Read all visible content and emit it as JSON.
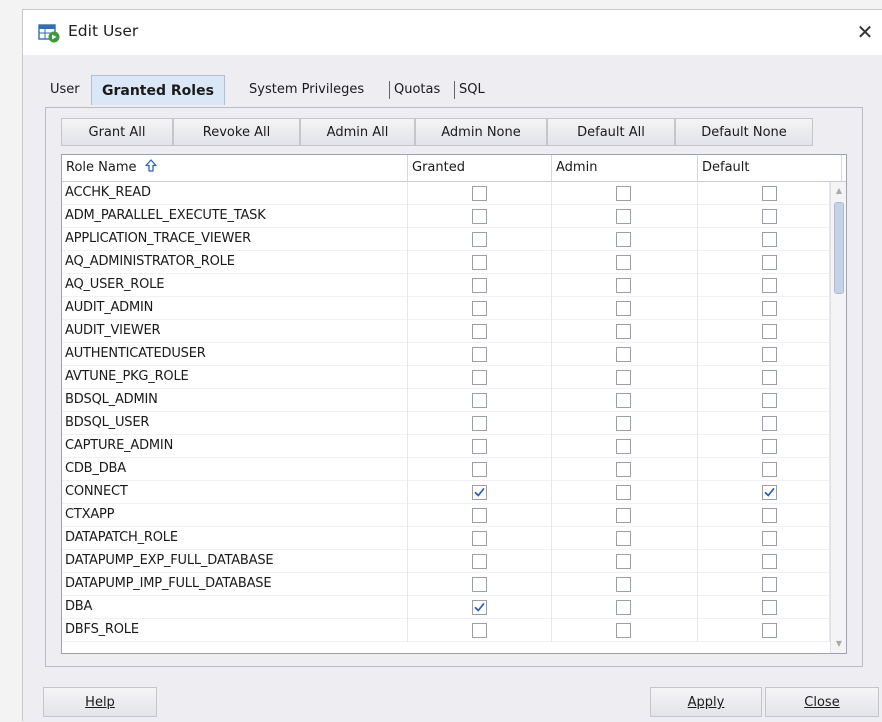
{
  "window": {
    "title": "Edit User",
    "close_glyph": "✕"
  },
  "tabs": [
    {
      "label": "User",
      "active": false
    },
    {
      "label": "Granted Roles",
      "active": true
    },
    {
      "label": "System Privileges",
      "active": false
    },
    {
      "label": "Quotas",
      "active": false
    },
    {
      "label": "SQL",
      "active": false
    }
  ],
  "toolbar": {
    "grant_all": "Grant All",
    "revoke_all": "Revoke All",
    "admin_all": "Admin All",
    "admin_none": "Admin None",
    "default_all": "Default All",
    "default_none": "Default None"
  },
  "grid": {
    "columns": [
      "Role Name",
      "Granted",
      "Admin",
      "Default"
    ],
    "sort_icon": "sort-ascending-icon",
    "rows": [
      {
        "name": "ACCHK_READ",
        "granted": false,
        "admin": false,
        "default": false
      },
      {
        "name": "ADM_PARALLEL_EXECUTE_TASK",
        "granted": false,
        "admin": false,
        "default": false
      },
      {
        "name": "APPLICATION_TRACE_VIEWER",
        "granted": false,
        "admin": false,
        "default": false
      },
      {
        "name": "AQ_ADMINISTRATOR_ROLE",
        "granted": false,
        "admin": false,
        "default": false
      },
      {
        "name": "AQ_USER_ROLE",
        "granted": false,
        "admin": false,
        "default": false
      },
      {
        "name": "AUDIT_ADMIN",
        "granted": false,
        "admin": false,
        "default": false
      },
      {
        "name": "AUDIT_VIEWER",
        "granted": false,
        "admin": false,
        "default": false
      },
      {
        "name": "AUTHENTICATEDUSER",
        "granted": false,
        "admin": false,
        "default": false
      },
      {
        "name": "AVTUNE_PKG_ROLE",
        "granted": false,
        "admin": false,
        "default": false
      },
      {
        "name": "BDSQL_ADMIN",
        "granted": false,
        "admin": false,
        "default": false
      },
      {
        "name": "BDSQL_USER",
        "granted": false,
        "admin": false,
        "default": false
      },
      {
        "name": "CAPTURE_ADMIN",
        "granted": false,
        "admin": false,
        "default": false
      },
      {
        "name": "CDB_DBA",
        "granted": false,
        "admin": false,
        "default": false
      },
      {
        "name": "CONNECT",
        "granted": true,
        "admin": false,
        "default": true
      },
      {
        "name": "CTXAPP",
        "granted": false,
        "admin": false,
        "default": false
      },
      {
        "name": "DATAPATCH_ROLE",
        "granted": false,
        "admin": false,
        "default": false
      },
      {
        "name": "DATAPUMP_EXP_FULL_DATABASE",
        "granted": false,
        "admin": false,
        "default": false
      },
      {
        "name": "DATAPUMP_IMP_FULL_DATABASE",
        "granted": false,
        "admin": false,
        "default": false
      },
      {
        "name": "DBA",
        "granted": true,
        "admin": false,
        "default": false
      },
      {
        "name": "DBFS_ROLE",
        "granted": false,
        "admin": false,
        "default": false
      }
    ]
  },
  "footer": {
    "help": "Help",
    "apply": "Apply",
    "close": "Close"
  },
  "colors": {
    "active_tab_bg": "#dbe7f6",
    "check_color": "#2b63c0",
    "scroll_thumb": "#c6d3e6"
  }
}
